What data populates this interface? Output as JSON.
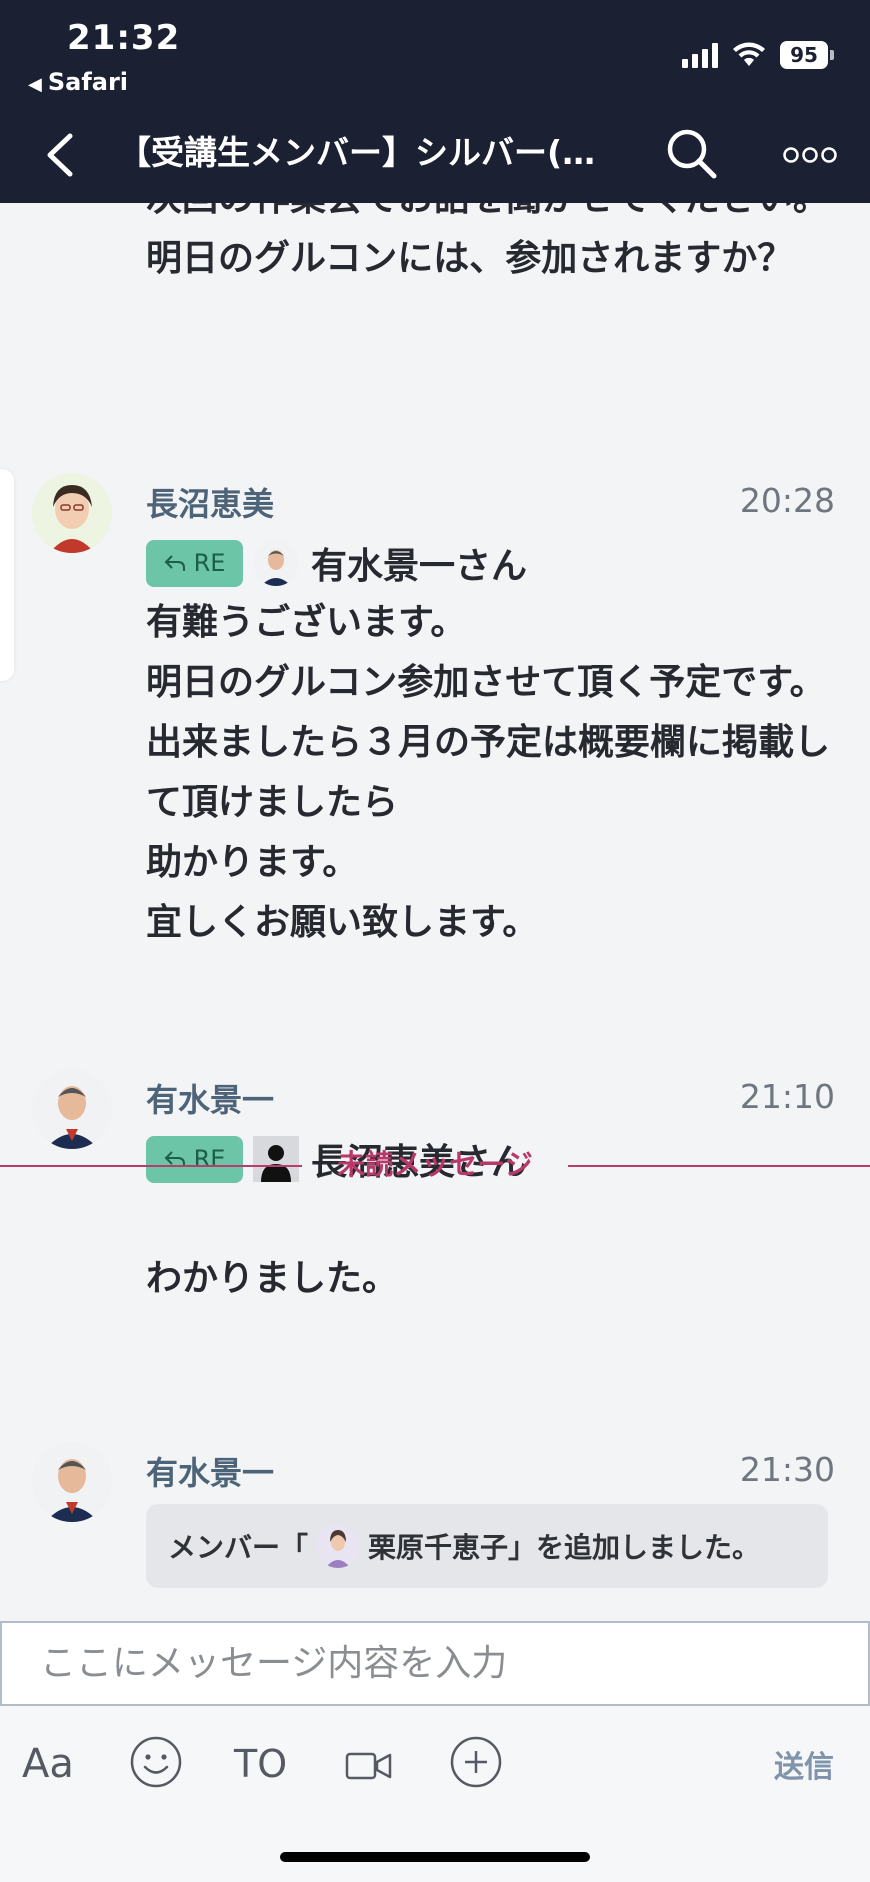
{
  "status_bar": {
    "time": "21:32",
    "back_app": "Safari",
    "battery": "95",
    "icons": [
      "signal-icon",
      "wifi-icon",
      "battery-icon"
    ]
  },
  "nav": {
    "title": "【受講生メンバー】シルバー(AI…",
    "icons": [
      "back-chevron-icon",
      "search-icon",
      "more-icon"
    ]
  },
  "previous_message": {
    "text": "次回の作業会でお話を聞かせてください。\n明日のグルコンには、参加されますか？"
  },
  "messages": [
    {
      "sender": "長沼恵美",
      "time": "20:28",
      "reply_label": "RE",
      "reply_to": "有水景一さん",
      "text": "有難うございます。\n明日のグルコン参加させて頂く予定です。\n出来ましたら３月の予定は概要欄に掲載して頂けましたら\n助かります。\n宜しくお願い致します。"
    },
    {
      "sender": "有水景一",
      "time": "21:10",
      "reply_label": "RE",
      "reply_to": "長沼恵美さん",
      "text": "\nわかりました。"
    },
    {
      "sender": "有水景一",
      "time": "21:30",
      "system_prefix": "メンバー「",
      "system_name": "栗原千恵子",
      "system_suffix": "」を追加しました。"
    }
  ],
  "divider": {
    "label": "未読メッセージ"
  },
  "composer": {
    "placeholder": "ここにメッセージ内容を入力",
    "value": ""
  },
  "toolbar": {
    "format_label": "Aa",
    "to_label": "TO",
    "send_label": "送信",
    "icons": [
      "emoji-icon",
      "video-icon",
      "add-icon"
    ]
  },
  "colors": {
    "header_bg": "#1b2133",
    "sender_name": "#4d6478",
    "re_badge": "#6bc5a6",
    "unread_divider": "#b8386a",
    "send_label": "#7f93ab"
  }
}
